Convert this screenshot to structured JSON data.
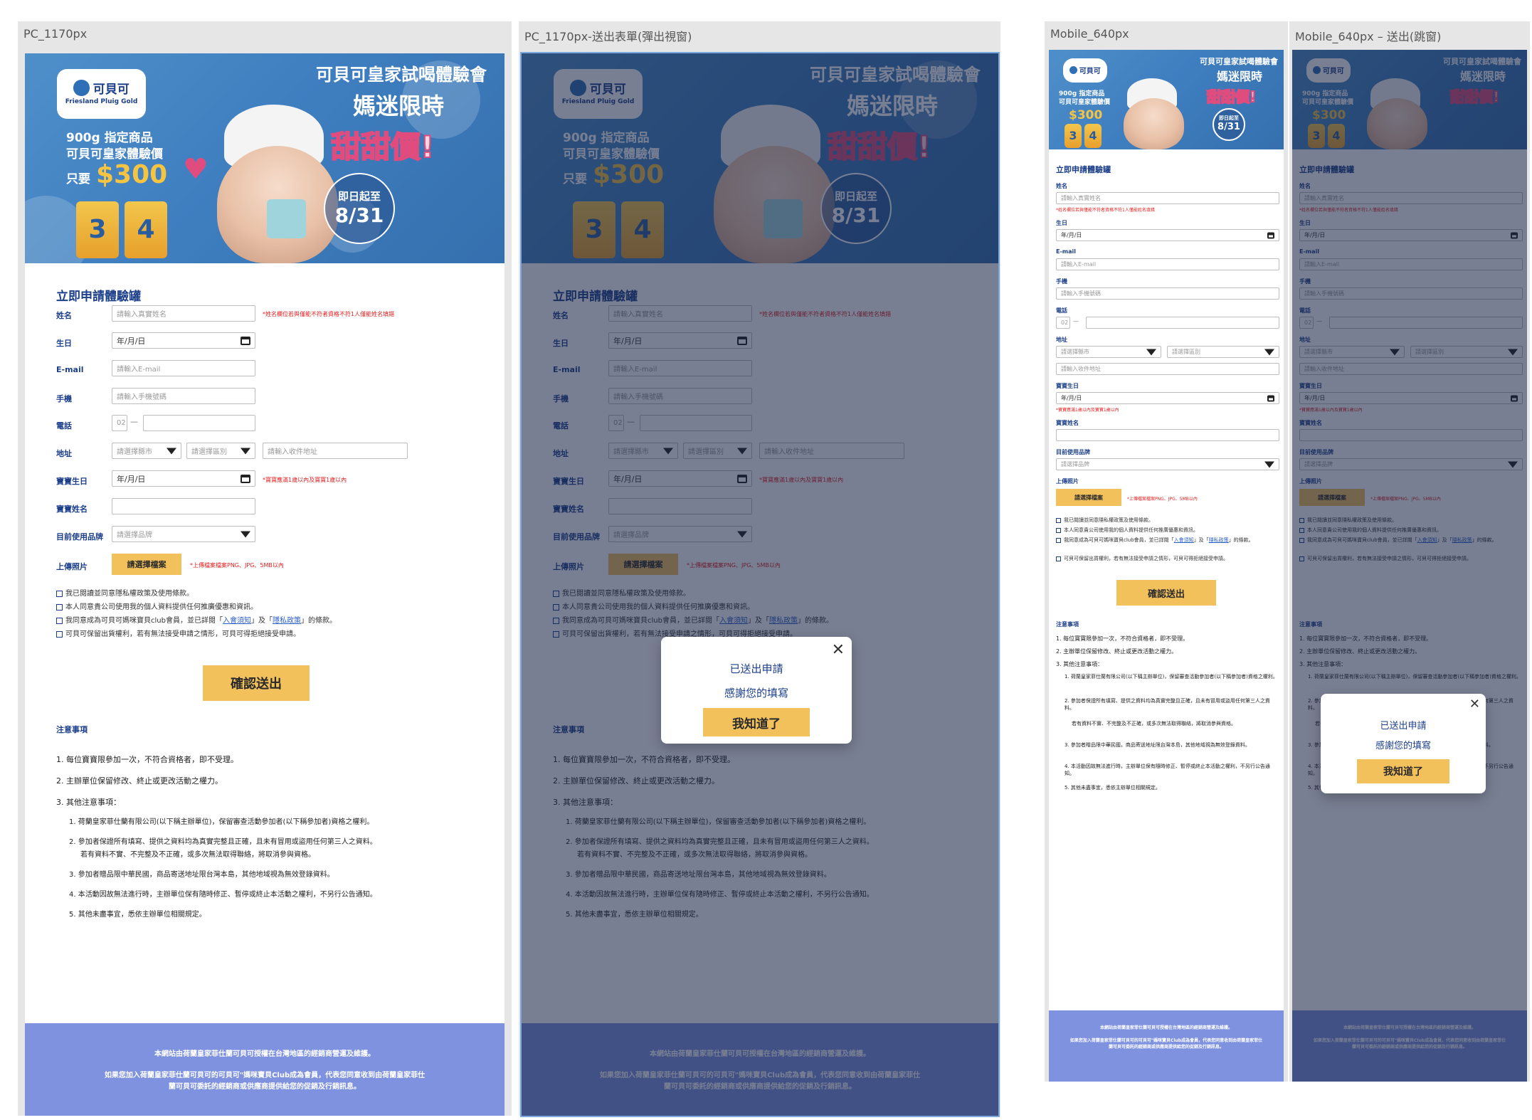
{
  "artboards": {
    "pc": "PC_1170px",
    "pc_modal": "PC_1170px-送出表單(彈出視窗)",
    "mobile": "Mobile_640px",
    "mobile_modal": "Mobile_640px – 送出(跳窗)"
  },
  "banner": {
    "brand": "可貝可",
    "brand_sub": "Friesland Pluig Gold",
    "headline_1": "可貝可皇家試喝體驗會",
    "headline_2": "媽迷限時",
    "headline_3": "甜甜價!",
    "promo_1": "900g 指定商品",
    "promo_2": "可貝可皇家體驗價",
    "promo_3": "只要",
    "price": "$300",
    "badge_1": "即日起至",
    "badge_2": "8/31",
    "can_3": "3",
    "can_4": "4"
  },
  "form": {
    "title": "立即申請體驗罐",
    "name_label": "姓名",
    "name_placeholder": "請輸入真實姓名",
    "name_hint": "*姓名欄位若與僅能不符者資格不符1人僅能姓名填錯",
    "birthday_label": "生日",
    "date_placeholder": "年/月/日",
    "email_label": "E-mail",
    "email_placeholder": "請輸入E-mail",
    "phone_label": "手機",
    "phone_placeholder": "請輸入手機號碼",
    "tel_label": "電話",
    "tel_area": "02",
    "tel_dash": "—",
    "address_label": "地址",
    "city_placeholder": "請選擇縣市",
    "district_placeholder": "請選擇區別",
    "address_placeholder": "請輸入收件地址",
    "baby_birthday_label": "寶寶生日",
    "baby_birthday_hint": "*寶寶應滿1歲以內及寶寶1歲以內",
    "baby_name_label": "寶寶姓名",
    "brand_label": "目前使用品牌",
    "brand_placeholder": "請選擇品牌",
    "upload_label": "上傳照片",
    "upload_button": "請選擇檔案",
    "upload_hint": "*上傳檔案檔案PNG、JPG、5MB以內",
    "check_1": "我已閱讀並同意隱私權政策及使用條款。",
    "check_2": "本人同意貴公司使用我的個人資料提供任何推廣優惠和資訊。",
    "check_3a": "我同意成為可貝可媽咪寶貝club會員，並已詳閱「",
    "check_3_link1": "入會須知",
    "check_3b": "」及「",
    "check_3_link2": "隱私政策",
    "check_3c": "」的條款。",
    "check_4": "可貝可保留出貨權利，若有無法接受申請之情形，可貝可得拒絕接受申請。",
    "submit": "確認送出"
  },
  "notes": {
    "title": "注意事項",
    "n1": "1. 每位寶寶限參加一次，不符合資格者，即不受理。",
    "n2": "2. 主辦單位保留修改、終止或更改活動之權力。",
    "n3": "3. 其他注意事項：",
    "s1": "1. 荷蘭皇家菲仕蘭有限公司(以下稱主辦單位)，保留審查活動參加者(以下稱參加者)資格之權利。",
    "s2a": "2. 參加者保證所有填寫、提供之資料均為真實完整且正確，且未有冒用或盜用任何第三人之資料。",
    "s2b": "若有資料不實、不完整及不正確，或多次無法取得聯絡，將取消參與資格。",
    "s3": "3. 參加者贈品限中華民國，商品寄送地址限台灣本島，其他地域視為無效登錄資料。",
    "s4": "4. 本活動因故無法進行時，主辦單位保有隨時修正、暫停或終止本活動之權利，不另行公告通知。",
    "s5": "5. 其他未盡事宜，悉依主辦單位相關規定。"
  },
  "footer": {
    "line1": "本網站由荷蘭皇家菲仕蘭可貝可授權在台灣地區的經銷商營運及維護。",
    "line2": "如果您加入荷蘭皇家菲仕蘭可貝可的可貝可\"媽咪寶貝Club成為會員，代表您同意收到由荷蘭皇家菲仕",
    "line3": "蘭可貝可委託的經銷商或供應商提供給您的促銷及行銷訊息。"
  },
  "modal": {
    "line1": "已送出申請",
    "line2": "感謝您的填寫",
    "button": "我知道了",
    "close": "✕"
  },
  "colors": {
    "brand_blue": "#1c3f8a",
    "button_yellow": "#f2c15b",
    "hint_red": "#e02020",
    "footer_blue": "#7f92df",
    "banner_blue": "#3f7fc0"
  }
}
